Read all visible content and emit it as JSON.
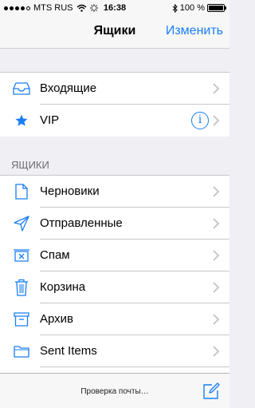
{
  "status_bar": {
    "carrier": "MTS RUS",
    "time": "16:38",
    "battery": "100 %",
    "battery_level": 1.0
  },
  "nav": {
    "title": "Ящики",
    "edit_label": "Изменить"
  },
  "top_items": [
    {
      "label": "Входящие",
      "icon": "inbox-tray-icon"
    },
    {
      "label": "VIP",
      "icon": "star-icon",
      "info": "i"
    }
  ],
  "section_header": "ЯЩИКИ",
  "mailboxes": [
    {
      "label": "Черновики",
      "icon": "document-icon"
    },
    {
      "label": "Отправленные",
      "icon": "paper-plane-icon"
    },
    {
      "label": "Спам",
      "icon": "junk-tray-icon"
    },
    {
      "label": "Корзина",
      "icon": "trash-icon"
    },
    {
      "label": "Архив",
      "icon": "archive-box-icon"
    },
    {
      "label": "Sent Items",
      "icon": "folder-icon"
    }
  ],
  "toolbar": {
    "status": "Проверка почты…"
  },
  "colors": {
    "accent": "#1a7ef5",
    "background": "#efeff4"
  }
}
